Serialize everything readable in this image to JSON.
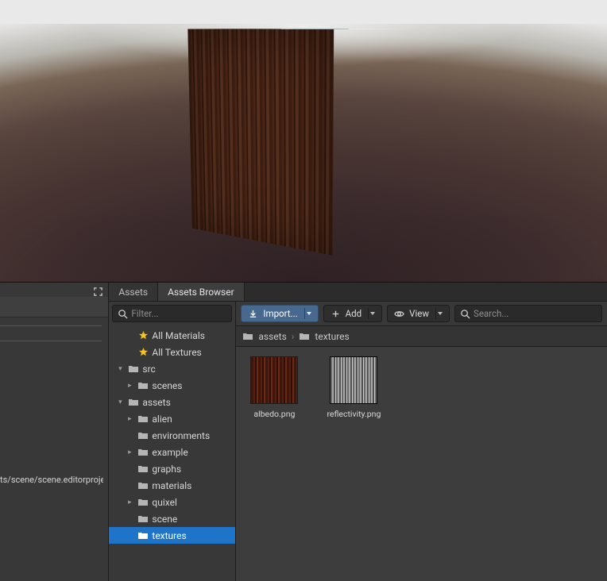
{
  "leftPane": {
    "path_fragment": "ts/scene/scene.editorproject"
  },
  "tabs": {
    "assets": "Assets",
    "browser": "Assets Browser"
  },
  "tree": {
    "filter_placeholder": "Filter...",
    "allMaterials": "All Materials",
    "allTextures": "All Textures",
    "src": "src",
    "scenes": "scenes",
    "assets": "assets",
    "alien": "alien",
    "environments": "environments",
    "example": "example",
    "graphs": "graphs",
    "materials": "materials",
    "quixel": "quixel",
    "scene": "scene",
    "textures": "textures"
  },
  "toolbar": {
    "import": "Import...",
    "add": "Add",
    "view": "View",
    "search_placeholder": "Search..."
  },
  "breadcrumb": {
    "seg1": "assets",
    "seg2": "textures"
  },
  "grid": {
    "items": [
      {
        "name": "albedo.png"
      },
      {
        "name": "reflectivity.png"
      }
    ]
  }
}
